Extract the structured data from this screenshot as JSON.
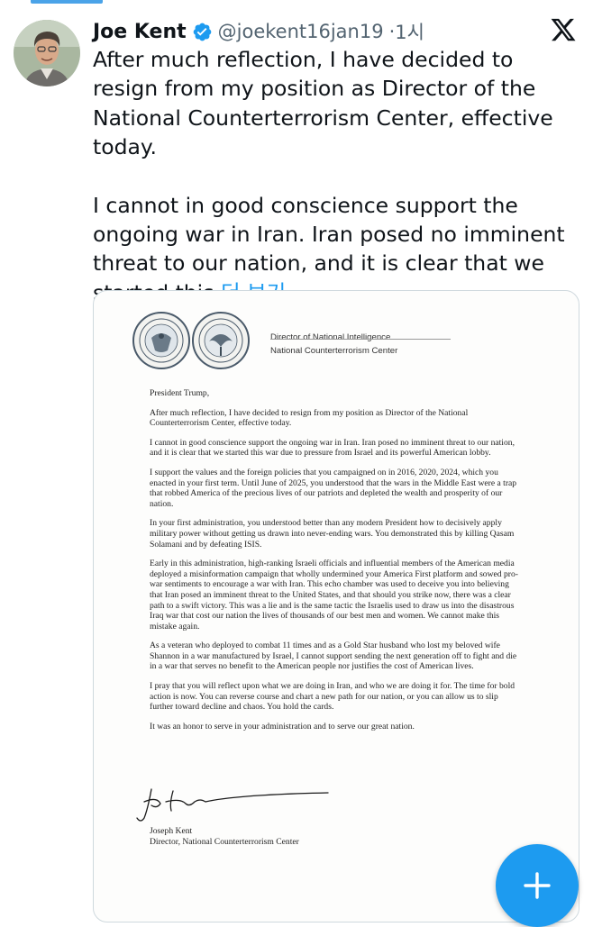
{
  "tweet": {
    "author_name": "Joe Kent",
    "author_handle": "@joekent16jan19",
    "separator": "·",
    "time": "1시",
    "verified": true,
    "text_p1": "After much reflection, I have decided to resign from my position as Director of the National Counterterrorism Center, effective today.",
    "text_p2": "I cannot in good conscience support the ongoing war in Iran. Iran posed no imminent threat to our nation, and it is clear that we started this",
    "show_more": "더 보기"
  },
  "letter": {
    "letterhead_line1": "Director of National Intelligence",
    "letterhead_line2": "National Counterterrorism Center",
    "salutation": "President Trump,",
    "paragraphs": [
      "After much reflection, I have decided to resign from my position as Director of the National Counterterrorism Center, effective today.",
      "I cannot in good conscience support the ongoing war in Iran. Iran posed no imminent threat to our nation, and it is clear that we started this war due to pressure from Israel and its powerful American lobby.",
      "I support the values and the foreign policies that you campaigned on in 2016, 2020, 2024, which you enacted in your first term. Until June of 2025, you understood that the wars in the Middle East were a trap that robbed America of the precious lives of our patriots and depleted the wealth and prosperity of our nation.",
      "In your first administration, you understood better than any modern President how to decisively apply military power without getting us drawn into never-ending wars. You demonstrated this by killing Qasam Solamani and by defeating ISIS.",
      "Early in this administration, high-ranking Israeli officials and influential members of the American media deployed a misinformation campaign that wholly undermined your America First platform and sowed pro-war sentiments to encourage a war with Iran. This echo chamber was used to deceive you into believing that Iran posed an imminent threat to the United States, and that should you strike now, there was a clear path to a swift victory. This was a lie and is the same tactic the Israelis used to draw us into the disastrous Iraq war that cost our nation the lives of thousands of our best men and women. We cannot make this mistake again.",
      "As a veteran who deployed to combat 11 times and as a Gold Star husband who lost my beloved wife Shannon in a war manufactured by Israel, I cannot support sending the next generation off to fight and die in a war that serves no benefit to the American people nor justifies the cost of American lives.",
      "I pray that you will reflect upon what we are doing in Iran, and who we are doing it for. The time for bold action is now. You can reverse course and chart a new path for our nation, or you can allow us to slip further toward decline and chaos. You hold the cards.",
      "It was an honor to serve in your administration and to serve our great nation."
    ],
    "signer_name": "Joseph Kent",
    "signer_title": "Director, National Counterterrorism Center"
  },
  "icons": {
    "verified": "verified-badge-icon",
    "platform": "x-logo-icon",
    "compose": "plus-icon"
  },
  "colors": {
    "link": "#1d9bf0",
    "fab": "#1d9bf0",
    "handle": "#536471",
    "text": "#0f1419"
  }
}
